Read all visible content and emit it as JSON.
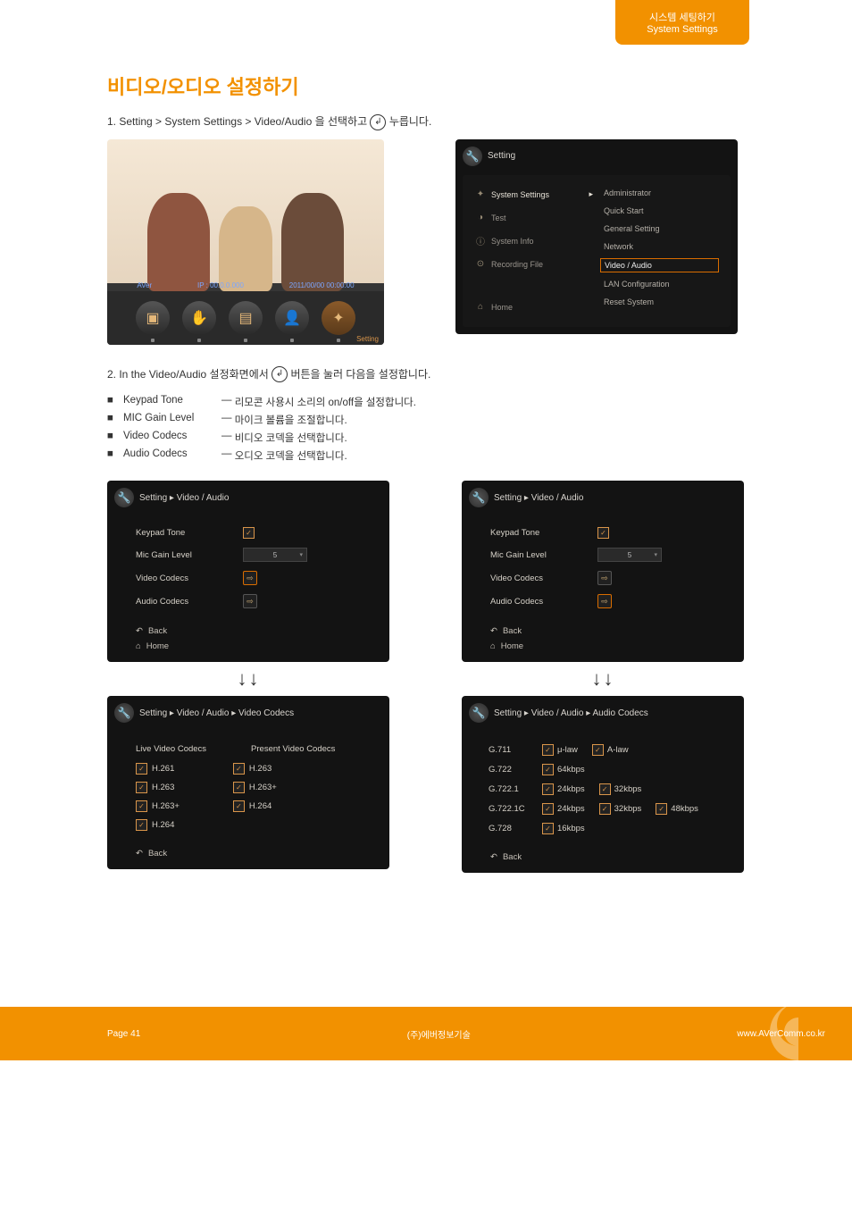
{
  "header": {
    "kor": "시스템 세팅하기",
    "eng": "System Settings"
  },
  "section_title": "비디오/오디오 설정하기",
  "step1_prefix": "1. ",
  "step1_body_a": "Setting > System Settings > Video/Audio 을 선택하고 ",
  "step1_body_b": " 누릅니다.",
  "thumb": {
    "brand": "AVer",
    "ip_label": "IP : 00.0.0.000",
    "date": "2011/00/00 00:00:00",
    "setting_label": "Setting"
  },
  "setting_menu": {
    "title": "Setting",
    "left": [
      "System Settings",
      "Test",
      "System Info",
      "Recording File"
    ],
    "home": "Home",
    "right": [
      "Administrator",
      "Quick Start",
      "General Setting",
      "Network",
      "Video / Audio",
      "LAN Configuration",
      "Reset System"
    ],
    "selected_index": 4
  },
  "step2_prefix": "2. ",
  "step2_body_a": "In the Video/Audio 설정화면에서 ",
  "step2_body_b": " 버튼을 눌러 다음을 설정합니다.",
  "bullets": [
    {
      "term": "Keypad Tone",
      "sep": "—",
      "desc": "리모콘 사용시 소리의 on/off을 설정합니다."
    },
    {
      "term": "MIC Gain Level",
      "sep": "—",
      "desc": "마이크 볼륨을 조절합니다."
    },
    {
      "term": "Video Codecs",
      "sep": "—",
      "desc": "비디오 코덱을 선택합니다."
    },
    {
      "term": "Audio Codecs",
      "sep": "—",
      "desc": "오디오 코덱을 선택합니다."
    }
  ],
  "va_panel": {
    "breadcrumb": "Setting ▸ Video / Audio",
    "keypad": "Keypad Tone",
    "mic": "Mic Gain Level",
    "mic_value": "5",
    "video": "Video Codecs",
    "audio": "Audio Codecs",
    "back": "Back",
    "home": "Home"
  },
  "video_codecs_panel": {
    "breadcrumb": "Setting ▸ Video / Audio ▸ Video Codecs",
    "live_hdr": "Live Video Codecs",
    "present_hdr": "Present Video Codecs",
    "live": [
      "H.261",
      "H.263",
      "H.263+",
      "H.264"
    ],
    "present": [
      "H.263",
      "H.263+",
      "H.264"
    ],
    "back": "Back"
  },
  "audio_codecs_panel": {
    "breadcrumb": "Setting ▸ Video / Audio ▸ Audio Codecs",
    "rows": [
      {
        "label": "G.711",
        "opts": [
          "μ-law",
          "A-law"
        ]
      },
      {
        "label": "G.722",
        "opts": [
          "64kbps"
        ]
      },
      {
        "label": "G.722.1",
        "opts": [
          "24kbps",
          "32kbps"
        ]
      },
      {
        "label": "G.722.1C",
        "opts": [
          "24kbps",
          "32kbps",
          "48kbps"
        ]
      },
      {
        "label": "G.728",
        "opts": [
          "16kbps"
        ]
      }
    ],
    "back": "Back"
  },
  "arrows": "↓↓",
  "footer": {
    "left": "Page 41",
    "center": "(주)에버정보기술",
    "right": "www.AVerComm.co.kr"
  }
}
